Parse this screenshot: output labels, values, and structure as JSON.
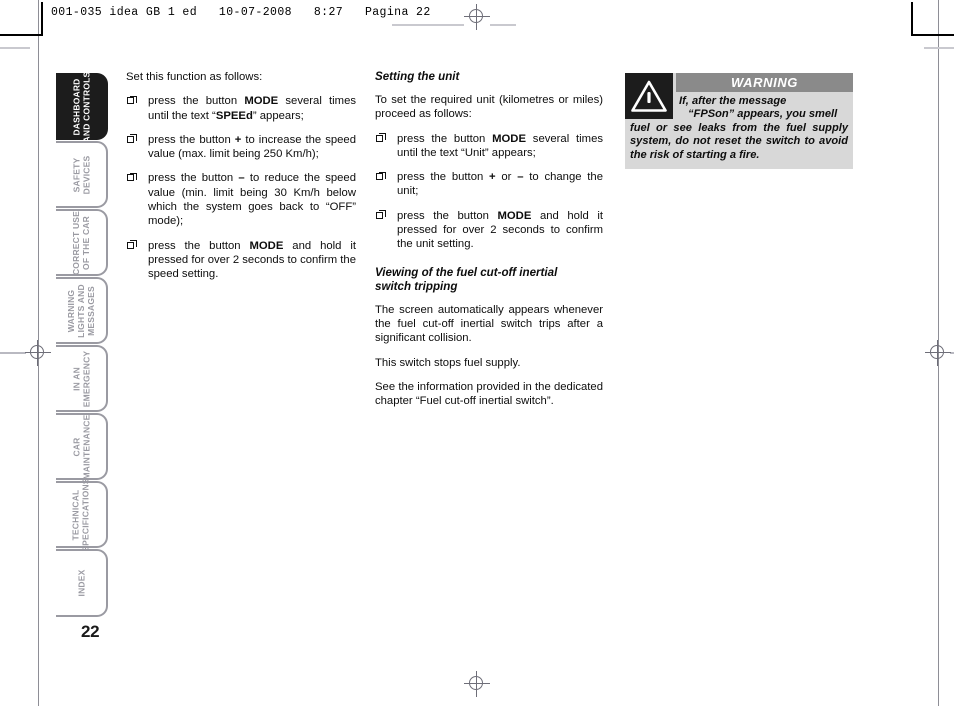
{
  "header": {
    "print_info": "001-035 idea GB 1 ed   10-07-2008   8:27   Pagina 22"
  },
  "page": {
    "number": "22"
  },
  "sidebar": {
    "tabs": [
      {
        "line1": "DASHBOARD",
        "line2": "AND CONTROLS",
        "active": true
      },
      {
        "line1": "SAFETY",
        "line2": "DEVICES",
        "active": false
      },
      {
        "line1": "CORRECT USE",
        "line2": "OF THE CAR",
        "active": false
      },
      {
        "line1": "WARNING",
        "line2": "LIGHTS AND",
        "line3": "MESSAGES",
        "active": false
      },
      {
        "line1": "IN AN",
        "line2": "EMERGENCY",
        "active": false
      },
      {
        "line1": "CAR",
        "line2": "MAINTENANCE",
        "active": false
      },
      {
        "line1": "TECHNICAL",
        "line2": "SPECIFICATIONS",
        "active": false
      },
      {
        "line1": "INDEX",
        "line2": "",
        "active": false
      }
    ]
  },
  "column_one": {
    "intro": "Set this function as follows:",
    "bullets": [
      {
        "pre": "press the button ",
        "bold1": "MODE",
        "mid": " several times until the text “",
        "bold2": "SPEEd",
        "post": "” appears;"
      },
      {
        "pre": "press the button ",
        "bold1": "+",
        "mid": " to increase the speed value (max. limit being 250 Km/h);",
        "bold2": "",
        "post": ""
      },
      {
        "pre": "press the button ",
        "bold1": "–",
        "mid": " to reduce the speed value (min. limit being 30 Km/h below which the system goes back to “OFF” mode);",
        "bold2": "",
        "post": ""
      },
      {
        "pre": "press the button ",
        "bold1": "MODE",
        "mid": " and hold it pressed for over 2 seconds to confirm the speed setting.",
        "bold2": "",
        "post": ""
      }
    ]
  },
  "column_two": {
    "heading_unit": "Setting the unit",
    "intro_unit": "To set the required unit (kilometres or miles) proceed as follows:",
    "bullets": [
      {
        "pre": "press the button ",
        "bold1": "MODE",
        "mid": " several times until the text “Unit” appears;",
        "bold2": "",
        "post": ""
      },
      {
        "pre": "press the button ",
        "bold1": "+",
        "mid": " or ",
        "bold2": "–",
        "post": " to change the unit;"
      },
      {
        "pre": "press the button ",
        "bold1": "MODE",
        "mid": " and hold it pressed for over 2 seconds to confirm the unit setting.",
        "bold2": "",
        "post": ""
      }
    ],
    "heading_viewing_line1": "Viewing of the fuel cut-off inertial",
    "heading_viewing_line2": "switch tripping",
    "para_1": "The screen automatically appears whenever the fuel cut-off inertial switch trips after a significant collision.",
    "para_2": "This switch stops fuel supply.",
    "para_3": "See the information provided in the dedicated chapter “Fuel cut-off inertial switch”."
  },
  "warning": {
    "title": "WARNING",
    "lead_line1": "If,    after    the    message",
    "lead_line2": "“FPSon” appears, you smell",
    "body": "fuel or see leaks from the fuel supply system, do not reset the switch to avoid the risk of starting a fire.",
    "icon": "warning-triangle-icon"
  },
  "colors": {
    "tab_active_bg": "#1c1c1c",
    "tab_inactive_border": "#9a9aa2",
    "warning_bg": "#d8d8d8",
    "warning_title_bg": "#8a8a8a",
    "text": "#0d0d0d"
  }
}
